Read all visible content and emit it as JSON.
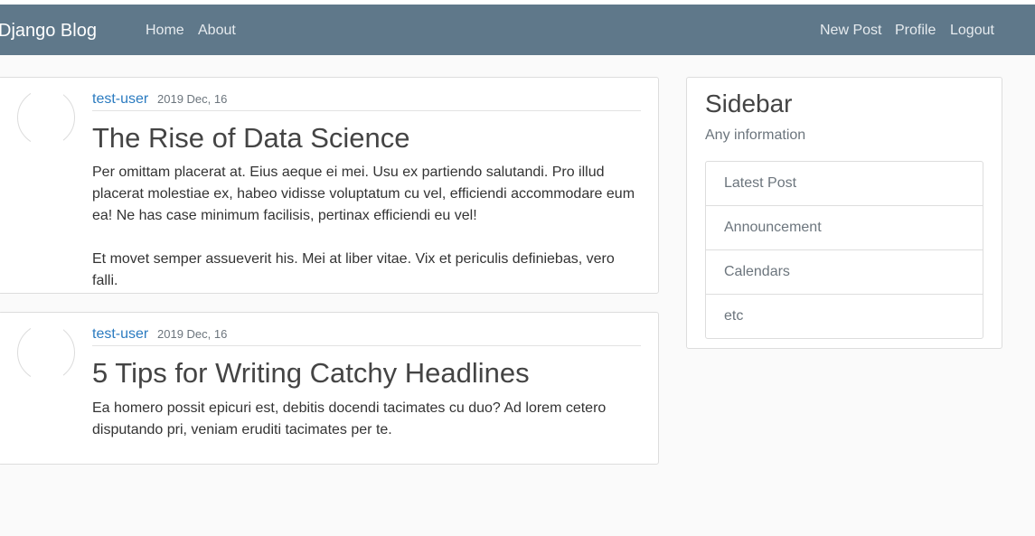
{
  "navbar": {
    "brand": "Django Blog",
    "left_links": [
      "Home",
      "About"
    ],
    "right_links": [
      "New Post",
      "Profile",
      "Logout"
    ]
  },
  "posts": [
    {
      "author": "test-user",
      "date": "2019 Dec, 16",
      "title": "The Rise of Data Science",
      "paragraphs": [
        "Per omittam placerat at. Eius aeque ei mei. Usu ex partiendo salutandi. Pro illud placerat molestiae ex, habeo vidisse voluptatum cu vel, efficiendi accommodare eum ea! Ne has case minimum facilisis, pertinax efficiendi eu vel!",
        "Et movet semper assueverit his. Mei at liber vitae. Vix et periculis definiebas, vero falli."
      ]
    },
    {
      "author": "test-user",
      "date": "2019 Dec, 16",
      "title": "5 Tips for Writing Catchy Headlines",
      "paragraphs": [
        "Ea homero possit epicuri est, debitis docendi tacimates cu duo? Ad lorem cetero disputando pri, veniam eruditi tacimates per te."
      ]
    }
  ],
  "sidebar": {
    "title": "Sidebar",
    "subtitle": "Any information",
    "items": [
      "Latest Post",
      "Announcement",
      "Calendars",
      "etc"
    ]
  },
  "colors": {
    "navbar": "#5f788a",
    "link": "#2b7bc0",
    "background": "#fafafa"
  }
}
